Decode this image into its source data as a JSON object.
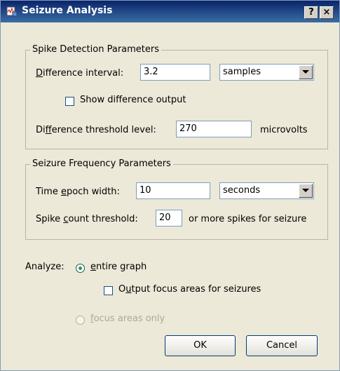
{
  "window": {
    "title": "Seizure Analysis",
    "help_button": "?",
    "close_button": "×"
  },
  "spike": {
    "group_title": "Spike Detection Parameters",
    "diff_interval_label_pre": "",
    "diff_interval_label_mnemonic": "D",
    "diff_interval_label_post": "ifference interval:",
    "diff_interval_value": "3.2",
    "diff_interval_unit": "samples",
    "show_diff_label": "Show difference output",
    "show_diff_checked": false,
    "threshold_label_pre": "Di",
    "threshold_label_mnemonic": "f",
    "threshold_label_post": "ference threshold level:",
    "threshold_value": "270",
    "threshold_unit": "microvolts"
  },
  "freq": {
    "group_title": "Seizure Frequency Parameters",
    "epoch_label_pre": "Time ",
    "epoch_label_mnemonic": "e",
    "epoch_label_post": "poch width:",
    "epoch_value": "10",
    "epoch_unit": "seconds",
    "count_label_pre": "Spike ",
    "count_label_mnemonic": "c",
    "count_label_post": "ount threshold:",
    "count_value": "20",
    "count_suffix": "or more spikes for seizure"
  },
  "analyze": {
    "label": "Analyze:",
    "entire_graph_mnemonic": "e",
    "entire_graph_rest": "ntire graph",
    "output_focus_pre": "O",
    "output_focus_mnemonic": "u",
    "output_focus_post": "tput focus areas for seizures",
    "focus_only_mnemonic": "f",
    "focus_only_rest": "ocus areas only"
  },
  "buttons": {
    "ok": "OK",
    "cancel": "Cancel"
  }
}
